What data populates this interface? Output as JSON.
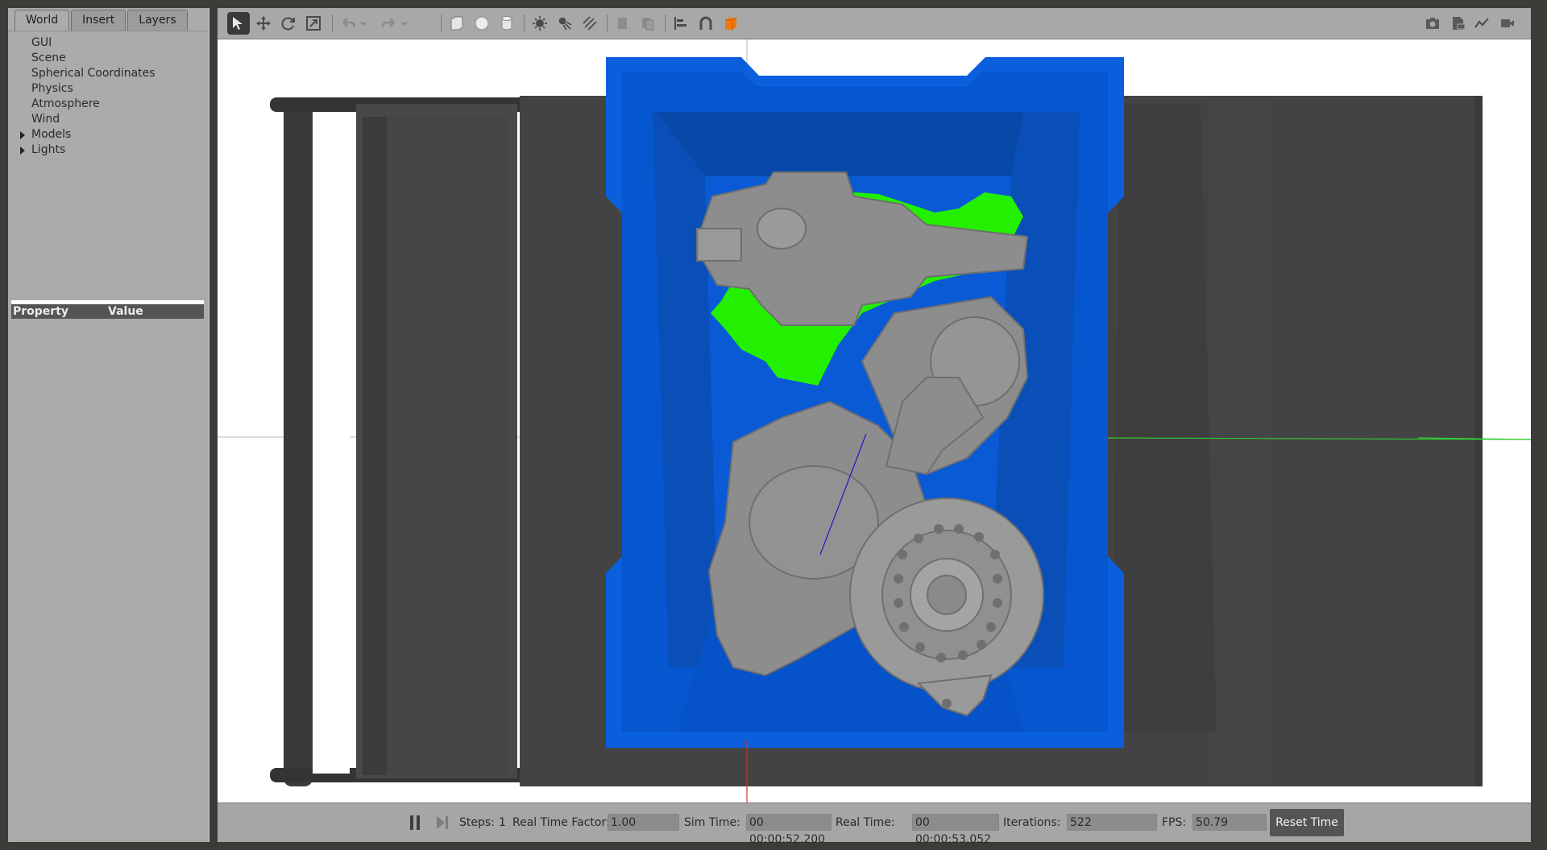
{
  "tabs": [
    {
      "label": "World",
      "active": true
    },
    {
      "label": "Insert",
      "active": false
    },
    {
      "label": "Layers",
      "active": false
    }
  ],
  "world_tree": [
    {
      "label": "GUI",
      "expandable": false
    },
    {
      "label": "Scene",
      "expandable": false
    },
    {
      "label": "Spherical Coordinates",
      "expandable": false
    },
    {
      "label": "Physics",
      "expandable": false
    },
    {
      "label": "Atmosphere",
      "expandable": false
    },
    {
      "label": "Wind",
      "expandable": false
    },
    {
      "label": "Models",
      "expandable": true
    },
    {
      "label": "Lights",
      "expandable": true
    }
  ],
  "property_table": {
    "col_property": "Property",
    "col_value": "Value"
  },
  "toolbar": {
    "icons": [
      "select-mode-icon",
      "translate-mode-icon",
      "rotate-mode-icon",
      "scale-mode-icon",
      "undo-icon",
      "undo-history-icon",
      "redo-icon",
      "redo-history-icon",
      "box-shape-icon",
      "sphere-shape-icon",
      "cylinder-shape-icon",
      "point-light-icon",
      "spot-light-icon",
      "directional-light-icon",
      "copy-icon",
      "paste-icon",
      "align-icon",
      "snap-icon",
      "view-angle-icon",
      "screenshot-icon",
      "log-data-icon",
      "plot-icon",
      "record-video-icon"
    ],
    "active": "select-mode-icon"
  },
  "status": {
    "steps_label": "Steps:",
    "steps_value": "1",
    "rtf_label": "Real Time Factor:",
    "rtf_value": "1.00",
    "sim_time_label": "Sim Time:",
    "sim_time_value": "00 00:00:52.200",
    "real_time_label": "Real Time:",
    "real_time_value": "00 00:00:53.052",
    "iterations_label": "Iterations:",
    "iterations_value": "522",
    "fps_label": "FPS:",
    "fps_value": "50.79",
    "reset_label": "Reset Time"
  },
  "colors": {
    "bin_blue": "#0a63e0",
    "bin_blue_dark": "#0553c4",
    "highlight_green": "#22f000",
    "parts_gray": "#8a8a8a",
    "conveyor_dark": "#3d3d3d",
    "toolbar_orange": "#f07a10"
  }
}
